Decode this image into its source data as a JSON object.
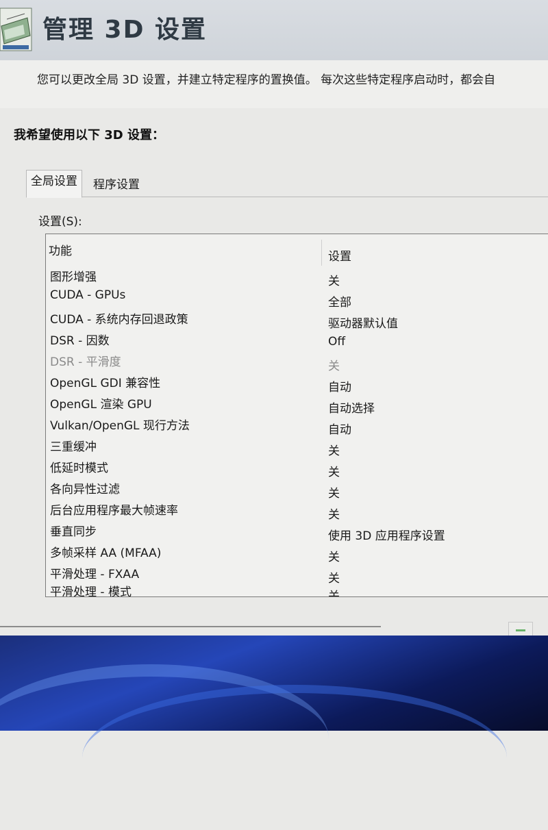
{
  "header": {
    "title": "管理 3D 设置",
    "description": "您可以更改全局 3D 设置，并建立特定程序的置换值。 每次这些特定程序启动时，都会自"
  },
  "section_heading": "我希望使用以下 3D 设置：",
  "tabs": [
    {
      "label": "全局设置",
      "selected": true
    },
    {
      "label": "程序设置",
      "selected": false
    }
  ],
  "settings_label": "设置(S):",
  "table": {
    "columns": [
      "功能",
      "设置"
    ],
    "rows": [
      {
        "feature": "图形增强",
        "value": "关"
      },
      {
        "feature": "CUDA - GPUs",
        "value": "全部"
      },
      {
        "feature": "CUDA - 系统内存回退政策",
        "value": "驱动器默认值"
      },
      {
        "feature": "DSR - 因数",
        "value": "Off"
      },
      {
        "feature": "DSR - 平滑度",
        "value": "关",
        "disabled": true
      },
      {
        "feature": "OpenGL GDI 兼容性",
        "value": "自动"
      },
      {
        "feature": "OpenGL 渲染 GPU",
        "value": "自动选择"
      },
      {
        "feature": "Vulkan/OpenGL 现行方法",
        "value": "自动"
      },
      {
        "feature": "三重缓冲",
        "value": "关"
      },
      {
        "feature": "低延时模式",
        "value": "关"
      },
      {
        "feature": "各向异性过滤",
        "value": "关"
      },
      {
        "feature": "后台应用程序最大帧速率",
        "value": "关"
      },
      {
        "feature": "垂直同步",
        "value": "使用 3D 应用程序设置"
      },
      {
        "feature": "多帧采样 AA (MFAA)",
        "value": "关"
      },
      {
        "feature": "平滑处理 - FXAA",
        "value": "关"
      },
      {
        "feature": "平滑处理 - 模式",
        "value": "关"
      }
    ]
  },
  "colors": {
    "header_bg": "#d3d8de",
    "title_text": "#2f3a44",
    "panel_bg": "#e9e9e7",
    "listbox_bg": "#f1f1ef",
    "disabled_text": "#8a8a8a",
    "taskbar_blue": "#2546b8"
  },
  "icons": [
    "nvidia-3d-settings-icon"
  ]
}
